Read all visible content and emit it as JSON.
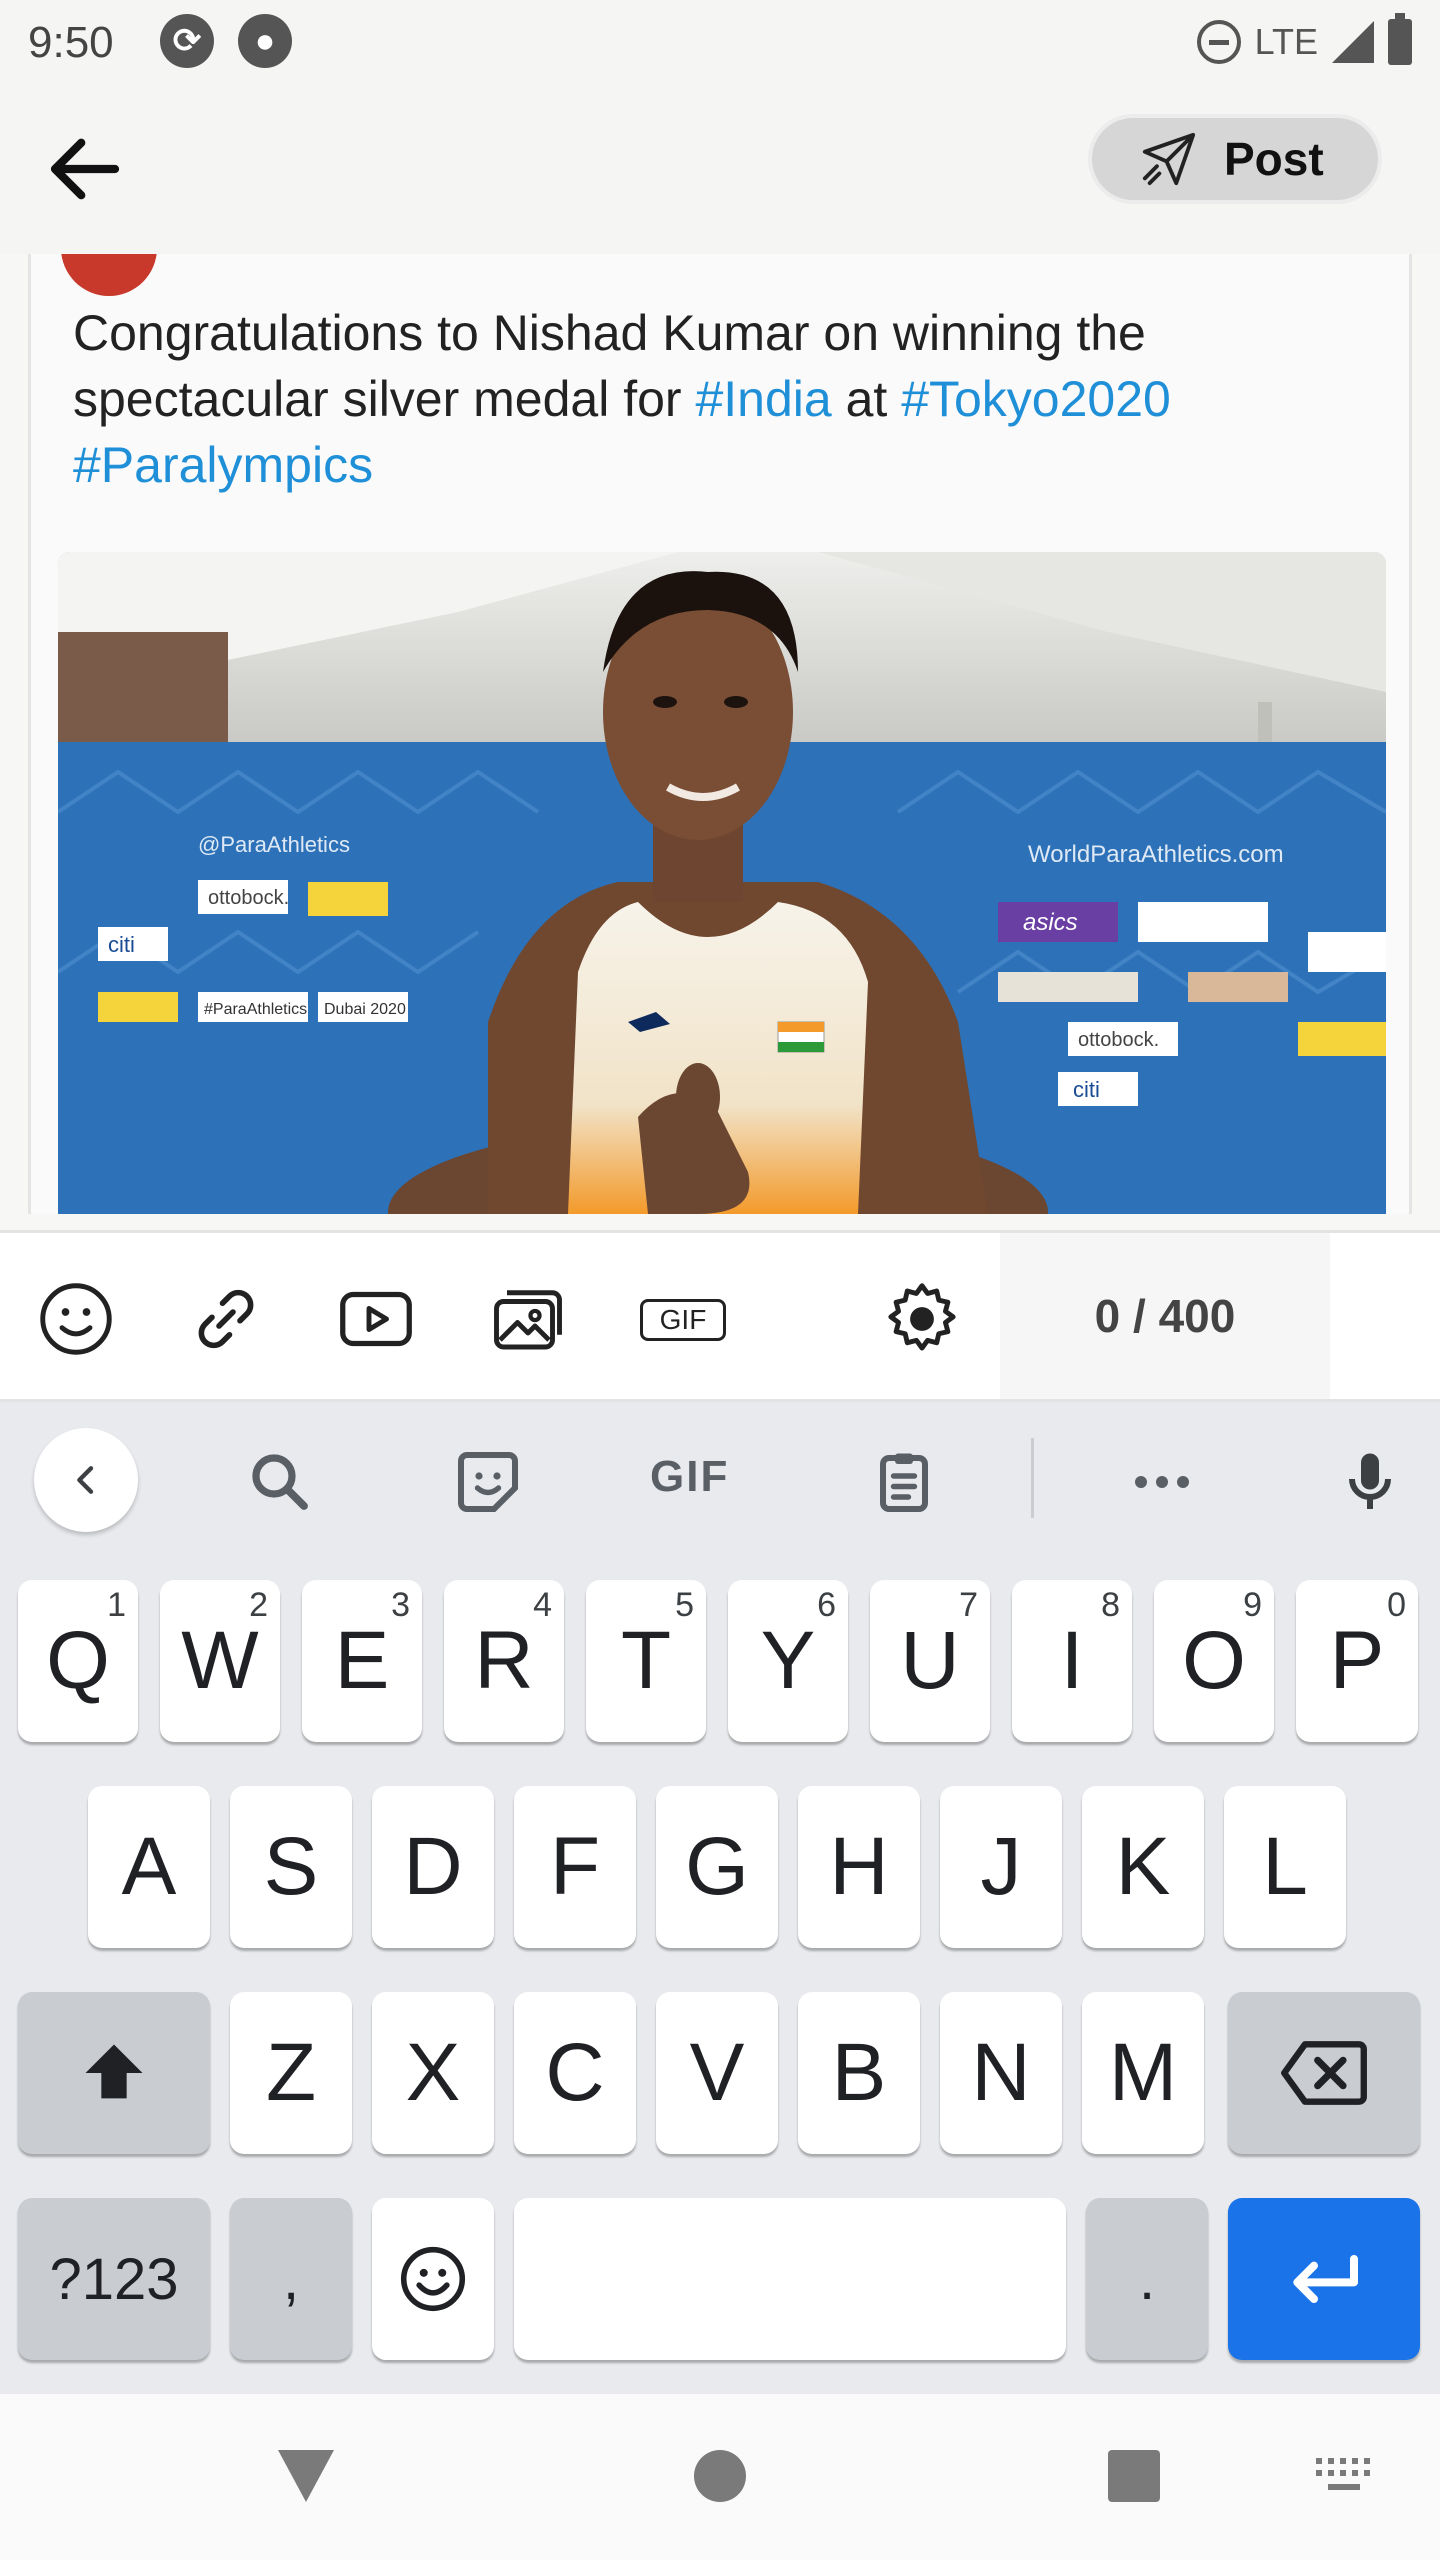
{
  "status_bar": {
    "time": "9:50",
    "network": "LTE",
    "icons": [
      "sync-icon",
      "app-badge-icon",
      "do-not-disturb-icon",
      "signal-icon",
      "battery-icon"
    ]
  },
  "header": {
    "post_label": "Post"
  },
  "post": {
    "text_parts": {
      "part1": "Congratulations to Nishad Kumar on winning the spectacular silver medal for ",
      "tag1": "#India",
      "part2": " at ",
      "tag2": "#Tokyo2020",
      "part3": " ",
      "tag3": "#Paralympics"
    },
    "hashtag_color": "#1f8fd8",
    "photo": {
      "sponsor_ottobock": "ottobock.",
      "sponsor_citi": "citi",
      "sponsor_asics": "asics",
      "handle": "@ParaAthletics",
      "site": "WorldParaAthletics.com",
      "para_athletics": "#ParaAthletics",
      "dubai": "Dubai 2020"
    }
  },
  "composer": {
    "tools": [
      "emoji-icon",
      "link-icon",
      "video-icon",
      "image-icon",
      "gif-icon",
      "settings-icon"
    ],
    "gif_label": "GIF",
    "counter": "0 / 400"
  },
  "keyboard": {
    "toolbar_gif": "GIF",
    "row1": [
      {
        "k": "Q",
        "h": "1"
      },
      {
        "k": "W",
        "h": "2"
      },
      {
        "k": "E",
        "h": "3"
      },
      {
        "k": "R",
        "h": "4"
      },
      {
        "k": "T",
        "h": "5"
      },
      {
        "k": "Y",
        "h": "6"
      },
      {
        "k": "U",
        "h": "7"
      },
      {
        "k": "I",
        "h": "8"
      },
      {
        "k": "O",
        "h": "9"
      },
      {
        "k": "P",
        "h": "0"
      }
    ],
    "row2": [
      "A",
      "S",
      "D",
      "F",
      "G",
      "H",
      "J",
      "K",
      "L"
    ],
    "row3": [
      "Z",
      "X",
      "C",
      "V",
      "B",
      "N",
      "M"
    ],
    "symbols_label": "?123",
    "comma": ",",
    "period": ".",
    "accent_color": "#1a73e8"
  }
}
